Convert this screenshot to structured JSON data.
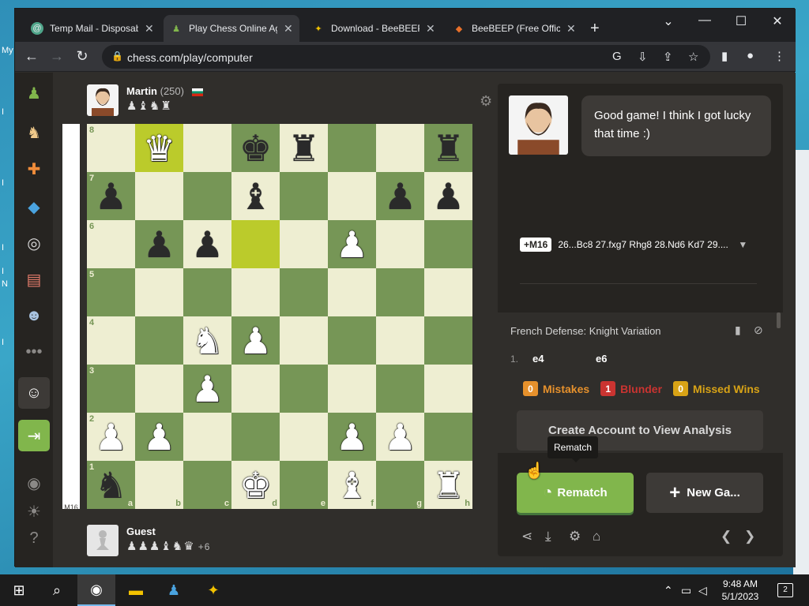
{
  "browser": {
    "tabs": [
      {
        "title": "Temp Mail - Disposab",
        "icon": "tempmail-icon",
        "color": "#4fa58a"
      },
      {
        "title": "Play Chess Online Ag",
        "icon": "chess-pawn-icon",
        "color": "#81b64c"
      },
      {
        "title": "Download - BeeBEEP",
        "icon": "bee-icon",
        "color": "#f2c200"
      },
      {
        "title": "BeeBEEP (Free Office",
        "icon": "diamond-icon",
        "color": "#e8702a"
      }
    ],
    "url": "chess.com/play/computer"
  },
  "desktop": {
    "left_text": [
      "My",
      "I",
      "I",
      "I",
      "I",
      "N",
      "I"
    ]
  },
  "top_player": {
    "name": "Martin",
    "rating": "(250)",
    "captured": "♟♝♞♜"
  },
  "bottom_player": {
    "name": "Guest",
    "captured": "♟♟♟♝♞♛",
    "advantage": "+6"
  },
  "eval_bar_label": "M16",
  "board": {
    "ranks": [
      "8",
      "7",
      "6",
      "5",
      "4",
      "3",
      "2",
      "1"
    ],
    "files": [
      "a",
      "b",
      "c",
      "d",
      "e",
      "f",
      "g",
      "h"
    ],
    "highlighted": [
      "b8",
      "d6"
    ],
    "position": [
      [
        "",
        "Q",
        "",
        "k",
        "r",
        "",
        "",
        "r"
      ],
      [
        "p",
        "",
        "",
        "b",
        "",
        "",
        "p",
        "p"
      ],
      [
        "",
        "p",
        "p",
        "",
        "",
        "P",
        "",
        ""
      ],
      [
        "",
        "",
        "",
        "",
        "",
        "",
        "",
        ""
      ],
      [
        "",
        "",
        "N",
        "P",
        "",
        "",
        "",
        ""
      ],
      [
        "",
        "",
        "P",
        "",
        "",
        "",
        "",
        ""
      ],
      [
        "P",
        "P",
        "",
        "",
        "",
        "P",
        "P",
        ""
      ],
      [
        "n",
        "",
        "",
        "K",
        "",
        "B",
        "",
        "R"
      ]
    ]
  },
  "coach": {
    "message": "Good game! I think I got lucky that time :)"
  },
  "engine": {
    "badge": "+M16",
    "line": "26...Bc8 27.fxg7 Rhg8 28.Nd6 Kd7 29...."
  },
  "moves": {
    "opening": "French Defense: Knight Variation",
    "list": [
      {
        "number": "1.",
        "white": "e4",
        "black": "e6"
      }
    ]
  },
  "stats": {
    "mistakes": {
      "count": "0",
      "label": "Mistakes",
      "color": "#e6912c"
    },
    "blunder": {
      "count": "1",
      "label": "Blunder",
      "color": "#ca3431"
    },
    "missed_wins": {
      "count": "0",
      "label": "Missed Wins",
      "color": "#d8a316"
    }
  },
  "actions": {
    "analysis": "Create Account to View Analysis",
    "tooltip": "Rematch",
    "rematch": "Rematch",
    "new_game": "New Ga..."
  },
  "taskbar": {
    "time": "9:48 AM",
    "date": "5/1/2023",
    "notifications": "2"
  }
}
